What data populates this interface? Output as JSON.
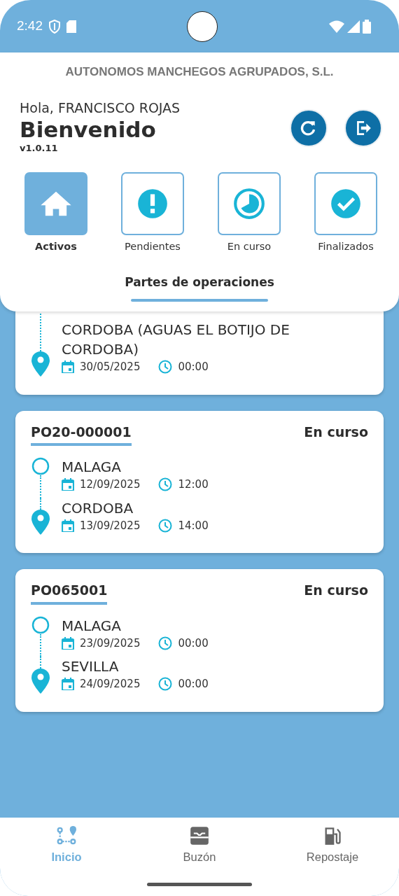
{
  "status_bar": {
    "time": "2:42"
  },
  "company": "AUTONOMOS MANCHEGOS AGRUPADOS, S.L.",
  "greeting": "Hola, FRANCISCO ROJAS",
  "title": "Bienvenido",
  "version": "v1.0.11",
  "header_buttons": [
    {
      "kind": "refresh"
    },
    {
      "kind": "logout"
    }
  ],
  "filters": [
    {
      "label": "Activos",
      "kind": "home",
      "selected": true
    },
    {
      "label": "Pendientes",
      "kind": "alert",
      "selected": false
    },
    {
      "label": "En curso",
      "kind": "clock",
      "selected": false
    },
    {
      "label": "Finalizados",
      "kind": "check",
      "selected": false
    }
  ],
  "section_title": "Partes de operaciones",
  "orders": [
    {
      "stops": [
        {
          "kind": "destination",
          "place": "CORDOBA (AGUAS EL BOTIJO DE CORDOBA)",
          "date": "30/05/2025",
          "time": "00:00"
        }
      ]
    },
    {
      "code": "PO20-000001",
      "status": "En curso",
      "stops": [
        {
          "kind": "origin",
          "place": "MALAGA",
          "date": "12/09/2025",
          "time": "12:00"
        },
        {
          "kind": "destination",
          "place": "CORDOBA",
          "date": "13/09/2025",
          "time": "14:00"
        }
      ]
    },
    {
      "code": "PO065001",
      "status": "En curso",
      "stops": [
        {
          "kind": "origin",
          "place": "MALAGA",
          "date": "23/09/2025",
          "time": "00:00"
        },
        {
          "kind": "destination",
          "place": "SEVILLA",
          "date": "24/09/2025",
          "time": "00:00"
        }
      ]
    }
  ],
  "bottom_nav": [
    {
      "label": "Inicio",
      "kind": "route",
      "selected": true
    },
    {
      "label": "Buzón",
      "kind": "inbox",
      "selected": false
    },
    {
      "label": "Repostaje",
      "kind": "fuel",
      "selected": false
    }
  ]
}
